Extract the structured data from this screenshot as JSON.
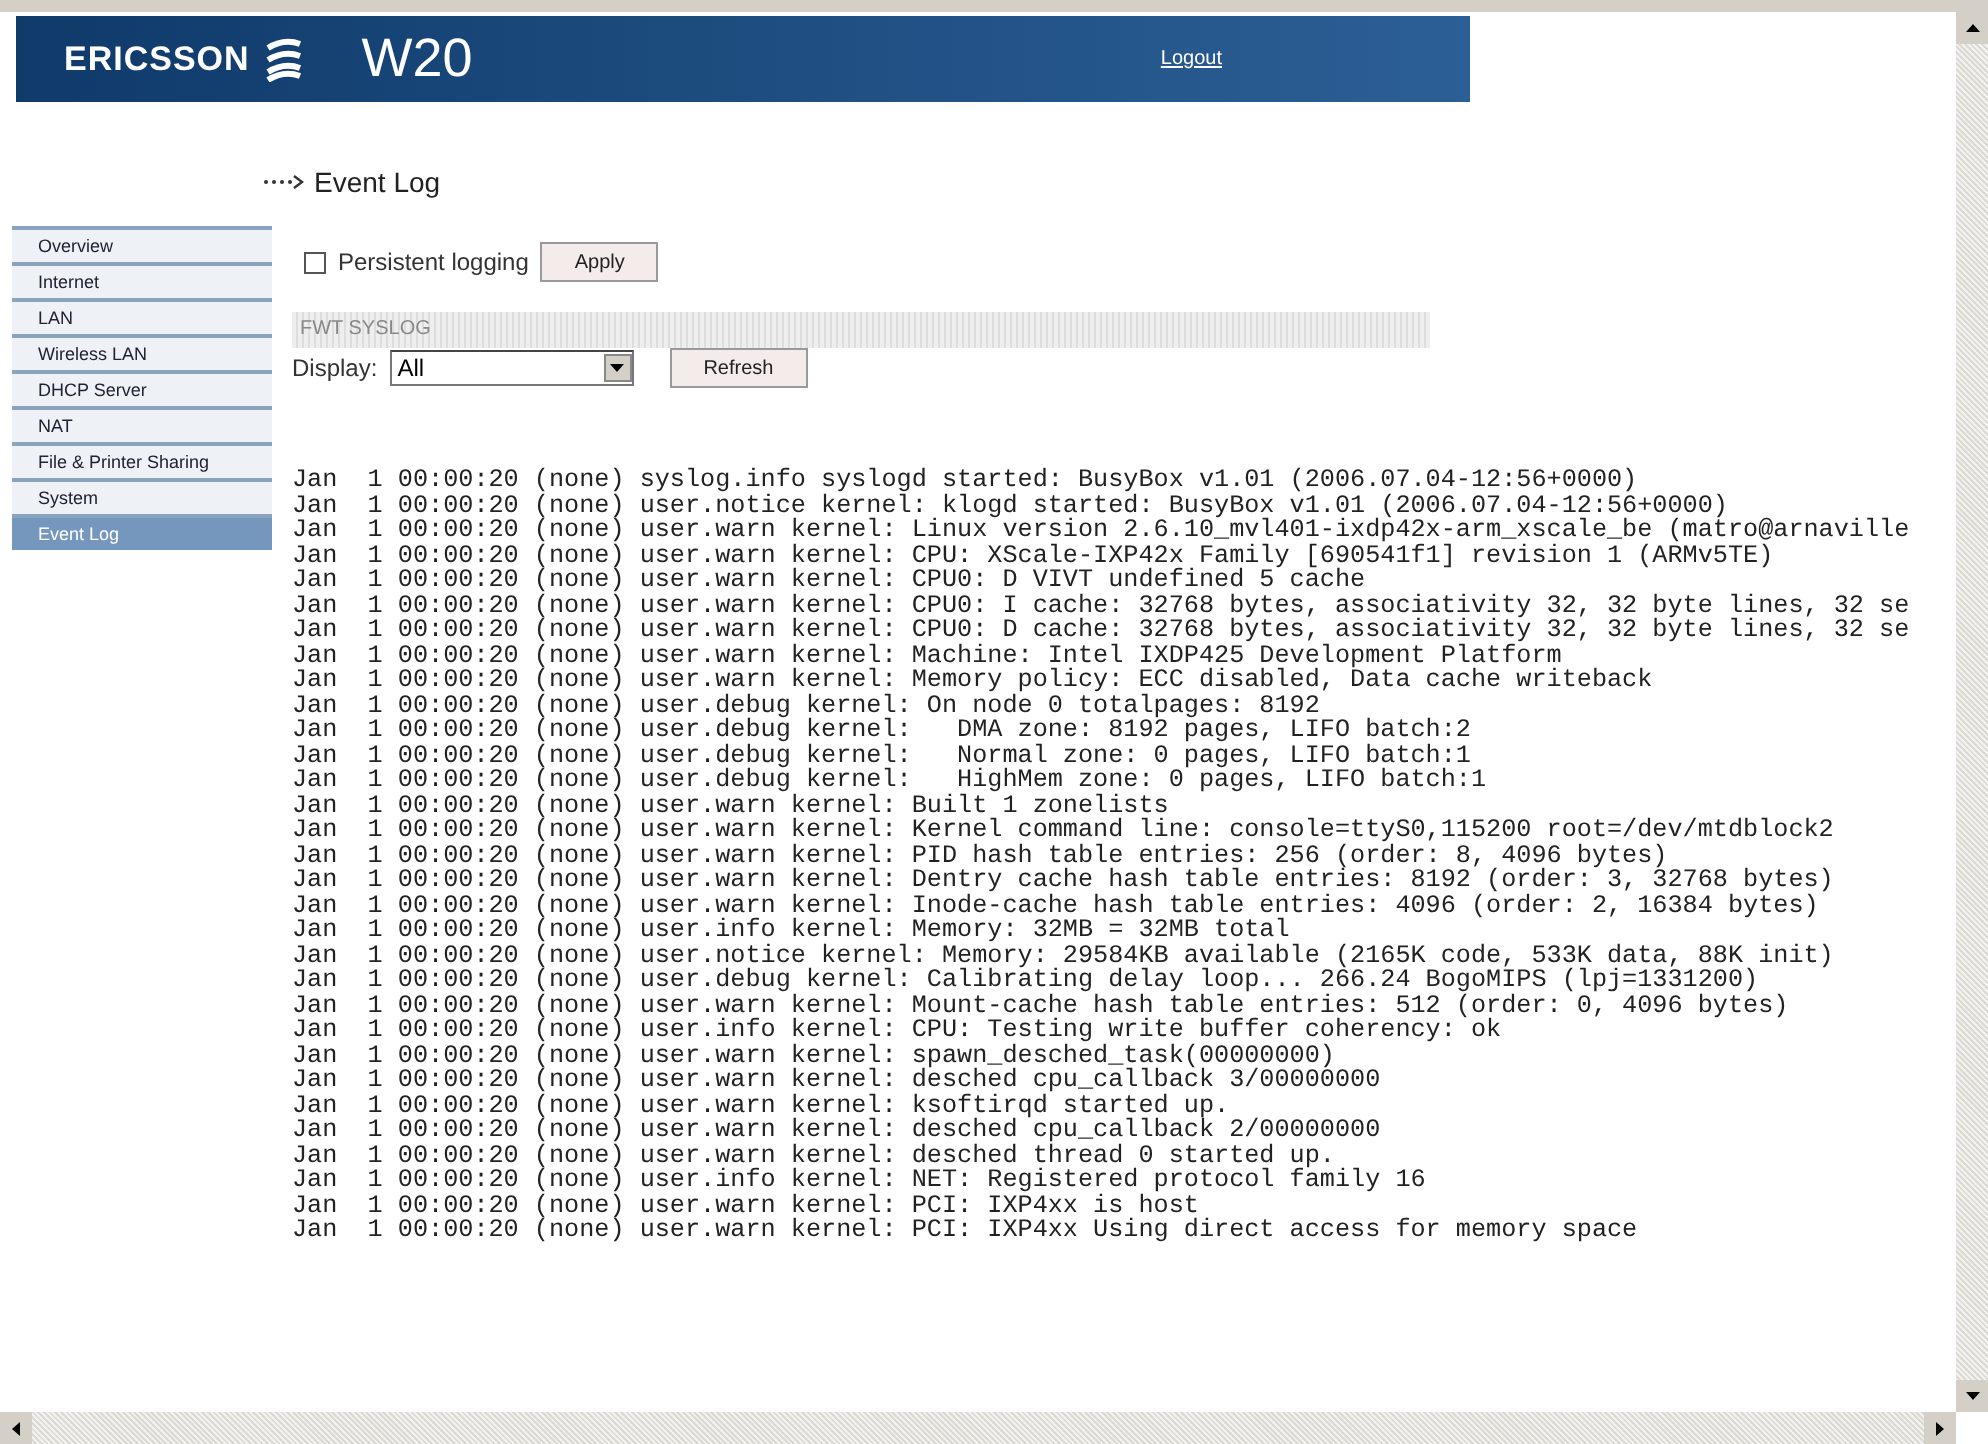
{
  "header": {
    "brand": "ERICSSON",
    "product": "W20",
    "logout": "Logout"
  },
  "page_title": "Event Log",
  "sidebar": {
    "items": [
      {
        "label": "Overview",
        "selected": false
      },
      {
        "label": "Internet",
        "selected": false
      },
      {
        "label": "LAN",
        "selected": false
      },
      {
        "label": "Wireless LAN",
        "selected": false
      },
      {
        "label": "DHCP Server",
        "selected": false
      },
      {
        "label": "NAT",
        "selected": false
      },
      {
        "label": "File & Printer Sharing",
        "selected": false
      },
      {
        "label": "System",
        "selected": false
      },
      {
        "label": "Event Log",
        "selected": true
      }
    ]
  },
  "persistent_logging": {
    "label": "Persistent logging",
    "checked": false,
    "button": "Apply"
  },
  "section_title": "FWT SYSLOG",
  "display": {
    "label": "Display:",
    "value": "All",
    "button": "Refresh"
  },
  "log_lines": [
    "Jan  1 00:00:20 (none) syslog.info syslogd started: BusyBox v1.01 (2006.07.04-12:56+0000)",
    "Jan  1 00:00:20 (none) user.notice kernel: klogd started: BusyBox v1.01 (2006.07.04-12:56+0000)",
    "Jan  1 00:00:20 (none) user.warn kernel: Linux version 2.6.10_mvl401-ixdp42x-arm_xscale_be (matro@arnaville",
    "Jan  1 00:00:20 (none) user.warn kernel: CPU: XScale-IXP42x Family [690541f1] revision 1 (ARMv5TE)",
    "Jan  1 00:00:20 (none) user.warn kernel: CPU0: D VIVT undefined 5 cache",
    "Jan  1 00:00:20 (none) user.warn kernel: CPU0: I cache: 32768 bytes, associativity 32, 32 byte lines, 32 se",
    "Jan  1 00:00:20 (none) user.warn kernel: CPU0: D cache: 32768 bytes, associativity 32, 32 byte lines, 32 se",
    "Jan  1 00:00:20 (none) user.warn kernel: Machine: Intel IXDP425 Development Platform",
    "Jan  1 00:00:20 (none) user.warn kernel: Memory policy: ECC disabled, Data cache writeback",
    "Jan  1 00:00:20 (none) user.debug kernel: On node 0 totalpages: 8192",
    "Jan  1 00:00:20 (none) user.debug kernel:   DMA zone: 8192 pages, LIFO batch:2",
    "Jan  1 00:00:20 (none) user.debug kernel:   Normal zone: 0 pages, LIFO batch:1",
    "Jan  1 00:00:20 (none) user.debug kernel:   HighMem zone: 0 pages, LIFO batch:1",
    "Jan  1 00:00:20 (none) user.warn kernel: Built 1 zonelists",
    "Jan  1 00:00:20 (none) user.warn kernel: Kernel command line: console=ttyS0,115200 root=/dev/mtdblock2",
    "Jan  1 00:00:20 (none) user.warn kernel: PID hash table entries: 256 (order: 8, 4096 bytes)",
    "Jan  1 00:00:20 (none) user.warn kernel: Dentry cache hash table entries: 8192 (order: 3, 32768 bytes)",
    "Jan  1 00:00:20 (none) user.warn kernel: Inode-cache hash table entries: 4096 (order: 2, 16384 bytes)",
    "Jan  1 00:00:20 (none) user.info kernel: Memory: 32MB = 32MB total",
    "Jan  1 00:00:20 (none) user.notice kernel: Memory: 29584KB available (2165K code, 533K data, 88K init)",
    "Jan  1 00:00:20 (none) user.debug kernel: Calibrating delay loop... 266.24 BogoMIPS (lpj=1331200)",
    "Jan  1 00:00:20 (none) user.warn kernel: Mount-cache hash table entries: 512 (order: 0, 4096 bytes)",
    "Jan  1 00:00:20 (none) user.info kernel: CPU: Testing write buffer coherency: ok",
    "Jan  1 00:00:20 (none) user.warn kernel: spawn_desched_task(00000000)",
    "Jan  1 00:00:20 (none) user.warn kernel: desched cpu_callback 3/00000000",
    "Jan  1 00:00:20 (none) user.warn kernel: ksoftirqd started up.",
    "Jan  1 00:00:20 (none) user.warn kernel: desched cpu_callback 2/00000000",
    "Jan  1 00:00:20 (none) user.warn kernel: desched thread 0 started up.",
    "Jan  1 00:00:20 (none) user.info kernel: NET: Registered protocol family 16",
    "Jan  1 00:00:20 (none) user.warn kernel: PCI: IXP4xx is host",
    "Jan  1 00:00:20 (none) user.warn kernel: PCI: IXP4xx Using direct access for memory space"
  ]
}
